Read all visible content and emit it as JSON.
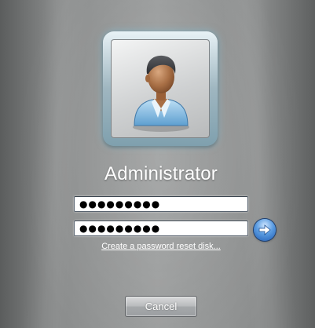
{
  "user": {
    "name": "Administrator",
    "tile_icon": "user-account-icon"
  },
  "login": {
    "password_masked": "●●●●●●●●●",
    "confirm_password_masked": "●●●●●●●●●",
    "submit_icon": "arrow-right-icon",
    "reset_link": "Create a password reset disk..."
  },
  "actions": {
    "cancel_label": "Cancel"
  },
  "colors": {
    "background": "#8a8c8c",
    "submit_button": "#2f73cf",
    "text": "#ffffff"
  }
}
